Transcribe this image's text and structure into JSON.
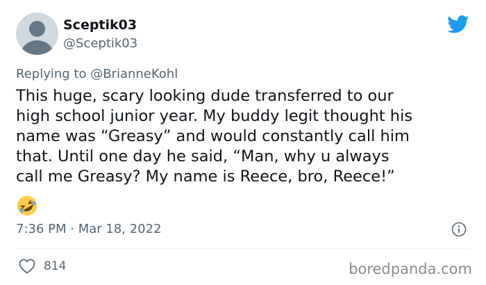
{
  "user": {
    "display_name": "Sceptik03",
    "handle": "@Sceptik03"
  },
  "reply": {
    "prefix": "Replying to ",
    "mention": "@BrianneKohl"
  },
  "tweet": {
    "text": "This huge, scary looking dude transferred to our\nhigh school junior year. My buddy legit thought his\nname was “Greasy” and would constantly call him\nthat. Until one day he said, “Man, why u always\ncall me Greasy? My name is Reece, bro, Reece!”",
    "emoji": "rolling-on-floor-laughing-emoji"
  },
  "meta": {
    "timestamp": "7:36 PM · Mar 18, 2022"
  },
  "engagement": {
    "likes": "814"
  },
  "watermark": "boredpanda.com",
  "colors": {
    "twitter_blue": "#1d9bf0",
    "secondary_text": "#536471",
    "emoji_yellow": "#ffcc4d"
  },
  "icons": [
    "twitter-bird-icon",
    "info-icon",
    "heart-icon"
  ]
}
